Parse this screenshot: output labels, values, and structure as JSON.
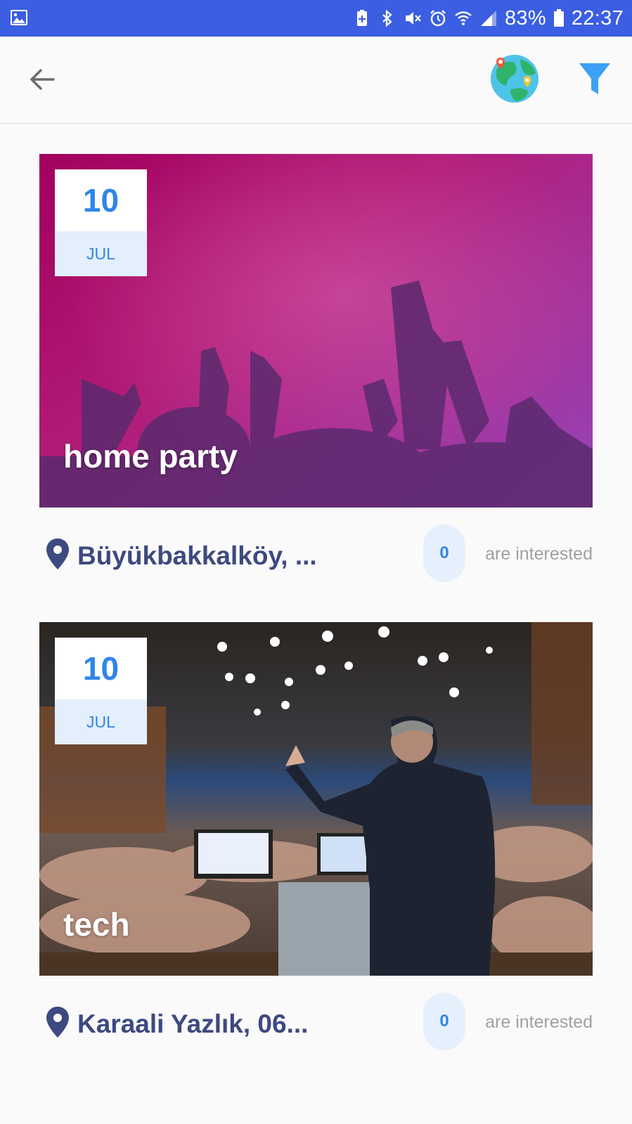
{
  "status_bar": {
    "battery": "83%",
    "time": "22:37",
    "icons": [
      "gallery-icon",
      "battery-saver-icon",
      "bluetooth-icon",
      "mute-icon",
      "alarm-icon",
      "wifi-icon",
      "signal-icon",
      "battery-icon"
    ]
  },
  "toolbar": {
    "icons": [
      "back-arrow-icon",
      "globe-map-icon",
      "filter-icon"
    ]
  },
  "events": [
    {
      "day": "10",
      "month": "JUL",
      "title": "home party",
      "location": "Büyükbakkalköy, ...",
      "interested_count": "0",
      "interested_label": "are interested"
    },
    {
      "day": "10",
      "month": "JUL",
      "title": "tech",
      "location": "Karaali Yazlık, 06...",
      "interested_count": "0",
      "interested_label": "are interested"
    }
  ],
  "colors": {
    "status_bar": "#3b5ee3",
    "accent_blue": "#2f86e8",
    "location_text": "#3d4a80",
    "badge_light": "#e3effc"
  }
}
